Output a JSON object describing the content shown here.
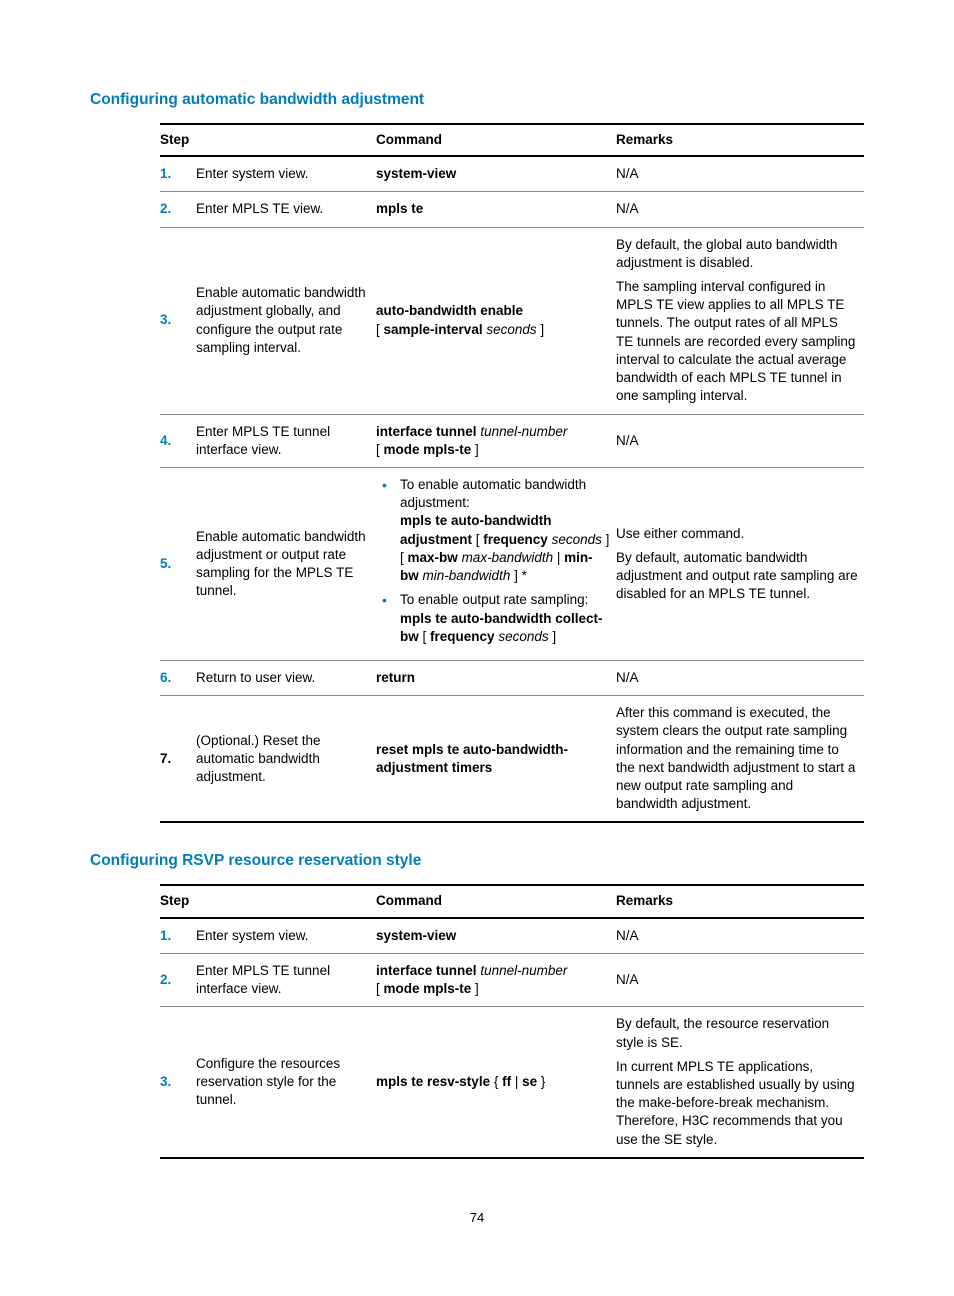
{
  "section1": {
    "title": "Configuring automatic bandwidth adjustment",
    "headers": {
      "step": "Step",
      "command": "Command",
      "remarks": "Remarks"
    },
    "rows": [
      {
        "num": "1.",
        "step": "Enter system view.",
        "command_html": "<span class=\"cmd-bold\">system-view</span>",
        "remarks_html": "N/A",
        "numLinked": true
      },
      {
        "num": "2.",
        "step": "Enter MPLS TE view.",
        "command_html": "<span class=\"cmd-bold\">mpls te</span>",
        "remarks_html": "N/A",
        "numLinked": true
      },
      {
        "num": "3.",
        "step": "Enable automatic bandwidth adjustment globally, and configure the output rate sampling interval.",
        "command_html": "<span class=\"cmd-bold\">auto-bandwidth enable</span><br>[ <span class=\"cmd-bold\">sample-interval</span> <span class=\"cmd-ital\">seconds</span> ]",
        "remarks_html": "<p>By default, the global auto bandwidth adjustment is disabled.</p><p>The sampling interval configured in MPLS TE view applies to all MPLS TE tunnels. The output rates of all MPLS TE tunnels are recorded every sampling interval to calculate the actual average bandwidth of each MPLS TE tunnel in one sampling interval.</p>",
        "numLinked": true
      },
      {
        "num": "4.",
        "step": "Enter MPLS TE tunnel interface view.",
        "command_html": "<span class=\"cmd-bold\">interface tunnel</span> <span class=\"cmd-ital\">tunnel-number</span><br>[ <span class=\"cmd-bold\">mode mpls-te</span> ]",
        "remarks_html": "N/A",
        "numLinked": true
      },
      {
        "num": "5.",
        "step": "Enable automatic bandwidth adjustment or output rate sampling for the MPLS TE tunnel.",
        "command_list": [
          "To enable automatic bandwidth adjustment:<br><span class=\"cmd-bold\">mpls te auto-bandwidth adjustment</span> [ <span class=\"cmd-bold\">frequency</span> <span class=\"cmd-ital\">seconds</span> ] [ <span class=\"cmd-bold\">max-bw</span> <span class=\"cmd-ital\">max-bandwidth</span> | <span class=\"cmd-bold\">min-bw</span> <span class=\"cmd-ital\">min-bandwidth</span> ] *",
          "To enable output rate sampling:<br><span class=\"cmd-bold\">mpls te auto-bandwidth collect-bw</span> [ <span class=\"cmd-bold\">frequency</span> <span class=\"cmd-ital\">seconds</span> ]"
        ],
        "remarks_html": "<p>Use either command.</p><p>By default, automatic bandwidth adjustment and output rate sampling are disabled for an MPLS TE tunnel.</p>",
        "numLinked": true
      },
      {
        "num": "6.",
        "step": "Return to user view.",
        "command_html": "<span class=\"cmd-bold\">return</span>",
        "remarks_html": "N/A",
        "numLinked": true
      },
      {
        "num": "7.",
        "step": "(Optional.) Reset the automatic bandwidth adjustment.",
        "command_html": "<span class=\"cmd-bold\">reset mpls te auto-bandwidth-adjustment timers</span>",
        "remarks_html": "After this command is executed, the system clears the output rate sampling information and the remaining time to the next bandwidth adjustment to start a new output rate sampling and bandwidth adjustment.",
        "numLinked": false
      }
    ]
  },
  "section2": {
    "title": "Configuring RSVP resource reservation style",
    "headers": {
      "step": "Step",
      "command": "Command",
      "remarks": "Remarks"
    },
    "rows": [
      {
        "num": "1.",
        "step": "Enter system view.",
        "command_html": "<span class=\"cmd-bold\">system-view</span>",
        "remarks_html": "N/A",
        "numLinked": true
      },
      {
        "num": "2.",
        "step": "Enter MPLS TE tunnel interface view.",
        "command_html": "<span class=\"cmd-bold\">interface tunnel</span> <span class=\"cmd-ital\">tunnel-number</span><br>[ <span class=\"cmd-bold\">mode mpls-te</span> ]",
        "remarks_html": "N/A",
        "numLinked": true
      },
      {
        "num": "3.",
        "step": "Configure the resources reservation style for the tunnel.",
        "command_html": "<span class=\"cmd-bold\">mpls te resv-style</span> { <span class=\"cmd-bold\">ff</span> | <span class=\"cmd-bold\">se</span> }",
        "remarks_html": "<p>By default, the resource reservation style is SE.</p><p>In current MPLS TE applications, tunnels are established usually by using the make-before-break mechanism. Therefore, H3C recommends that you use the SE style.</p>",
        "numLinked": true
      }
    ]
  },
  "pageNumber": "74"
}
